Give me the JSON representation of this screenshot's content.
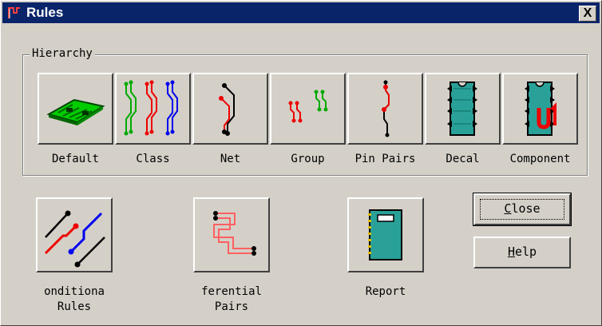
{
  "window": {
    "title": "Rules",
    "close_glyph": "X"
  },
  "hierarchy": {
    "label": "Hierarchy",
    "items": [
      {
        "label": "Default",
        "icon": "pcb-board-icon"
      },
      {
        "label": "Class",
        "icon": "class-traces-icon"
      },
      {
        "label": "Net",
        "icon": "net-trace-icon"
      },
      {
        "label": "Group",
        "icon": "group-traces-icon"
      },
      {
        "label": "Pin Pairs",
        "icon": "pin-pairs-icon"
      },
      {
        "label": "Decal",
        "icon": "decal-chip-icon"
      },
      {
        "label": "Component",
        "icon": "component-chip-icon"
      }
    ]
  },
  "rules": [
    {
      "label_line1": "onditiona",
      "label_line2": "Rules",
      "icon": "conditional-rules-icon"
    },
    {
      "label_line1": "ferential",
      "label_line2": "Pairs",
      "icon": "differential-pairs-icon"
    },
    {
      "label_line1": "Report",
      "label_line2": "",
      "icon": "report-icon"
    }
  ],
  "buttons": {
    "close": {
      "mnemonic": "C",
      "rest": "lose"
    },
    "help": {
      "mnemonic": "H",
      "rest": "elp"
    }
  },
  "colors": {
    "titlebar": "#0a246a",
    "face": "#d4d0c8",
    "teal": "#2aa198",
    "red": "#e00000"
  }
}
